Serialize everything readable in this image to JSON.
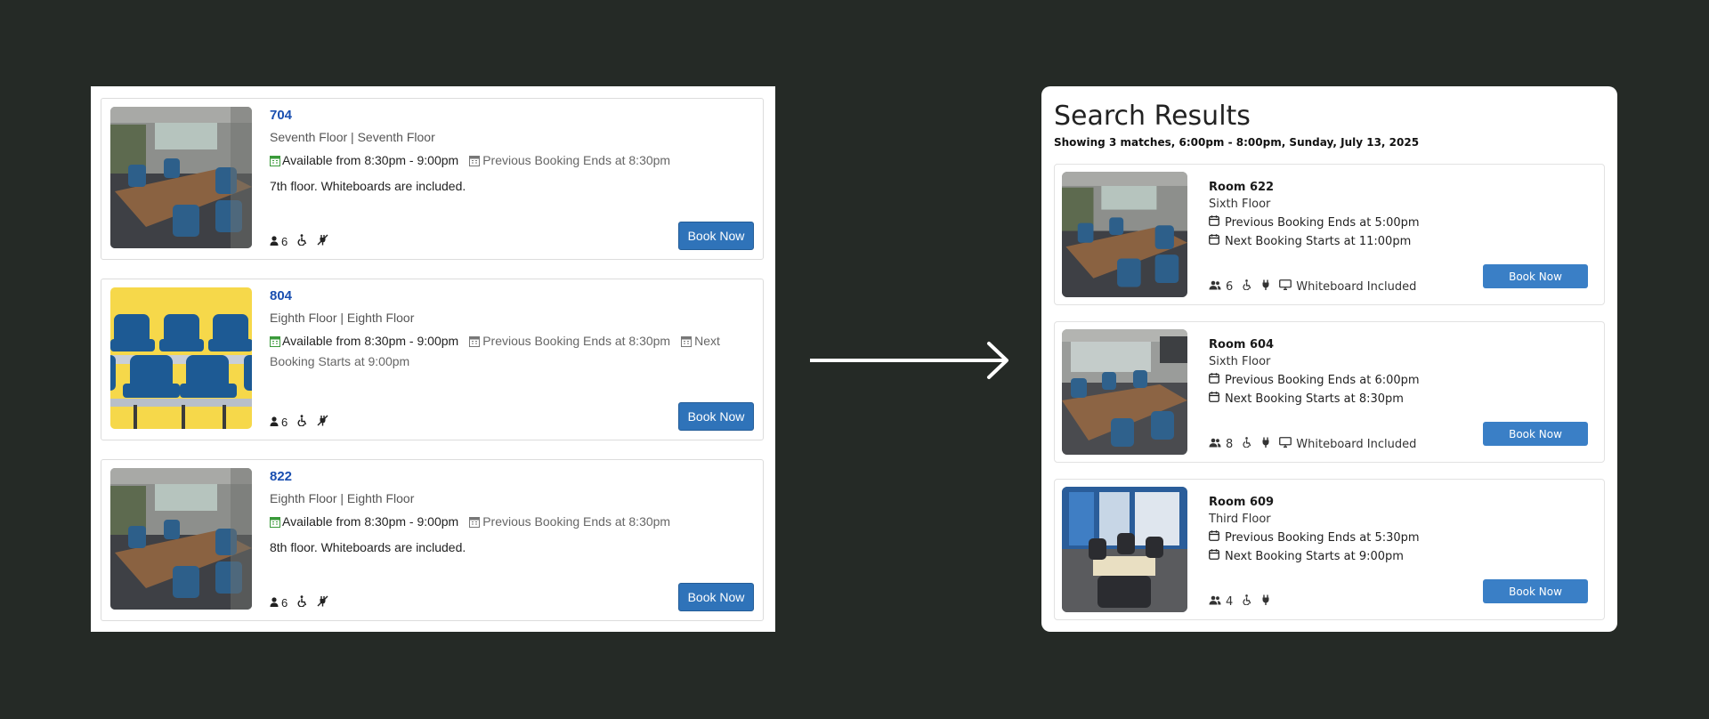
{
  "old_version": {
    "rooms": [
      {
        "title": "704",
        "floor": "Seventh Floor | Seventh Floor",
        "available": "Available from 8:30pm - 9:00pm",
        "previous": "Previous Booking Ends at 8:30pm",
        "next": "",
        "description": "7th floor. Whiteboards are included.",
        "capacity": "6",
        "button": "Book Now",
        "photo": "meeting-room-photo"
      },
      {
        "title": "804",
        "floor": "Eighth Floor | Eighth Floor",
        "available": "Available from 8:30pm - 9:00pm",
        "previous": "Previous Booking Ends at 8:30pm",
        "next": "Next Booking Starts at 9:00pm",
        "description": "",
        "capacity": "6",
        "button": "Book Now",
        "photo": "placeholder-chairs-illustration"
      },
      {
        "title": "822",
        "floor": "Eighth Floor | Eighth Floor",
        "available": "Available from 8:30pm - 9:00pm",
        "previous": "Previous Booking Ends at 8:30pm",
        "next": "",
        "description": "8th floor. Whiteboards are included.",
        "capacity": "6",
        "button": "Book Now",
        "photo": "meeting-room-photo"
      }
    ]
  },
  "new_version": {
    "heading": "Search Results",
    "subheading": "Showing 3 matches, 6:00pm - 8:00pm, Sunday, July 13, 2025",
    "rooms": [
      {
        "title": "Room 622",
        "floor": "Sixth Floor",
        "previous": "Previous Booking Ends at 5:00pm",
        "next": "Next Booking Starts at 11:00pm",
        "capacity": "6",
        "whiteboard": "Whiteboard Included",
        "button": "Book Now"
      },
      {
        "title": "Room 604",
        "floor": "Sixth Floor",
        "previous": "Previous Booking Ends at 6:00pm",
        "next": "Next Booking Starts at 8:30pm",
        "capacity": "8",
        "whiteboard": "Whiteboard Included",
        "button": "Book Now"
      },
      {
        "title": "Room 609",
        "floor": "Third Floor",
        "previous": "Previous Booking Ends at 5:30pm",
        "next": "Next Booking Starts at 9:00pm",
        "capacity": "4",
        "whiteboard": "",
        "button": "Book Now"
      }
    ]
  },
  "colors": {
    "page_background": "#252a26",
    "old_link": "#1a4fb0",
    "old_button": "#2f73b9",
    "new_button": "#3a7fc6",
    "calendar_green": "#3a9a3a",
    "placeholder_yellow": "#f6d84a",
    "placeholder_chair_blue": "#1d5a94"
  }
}
